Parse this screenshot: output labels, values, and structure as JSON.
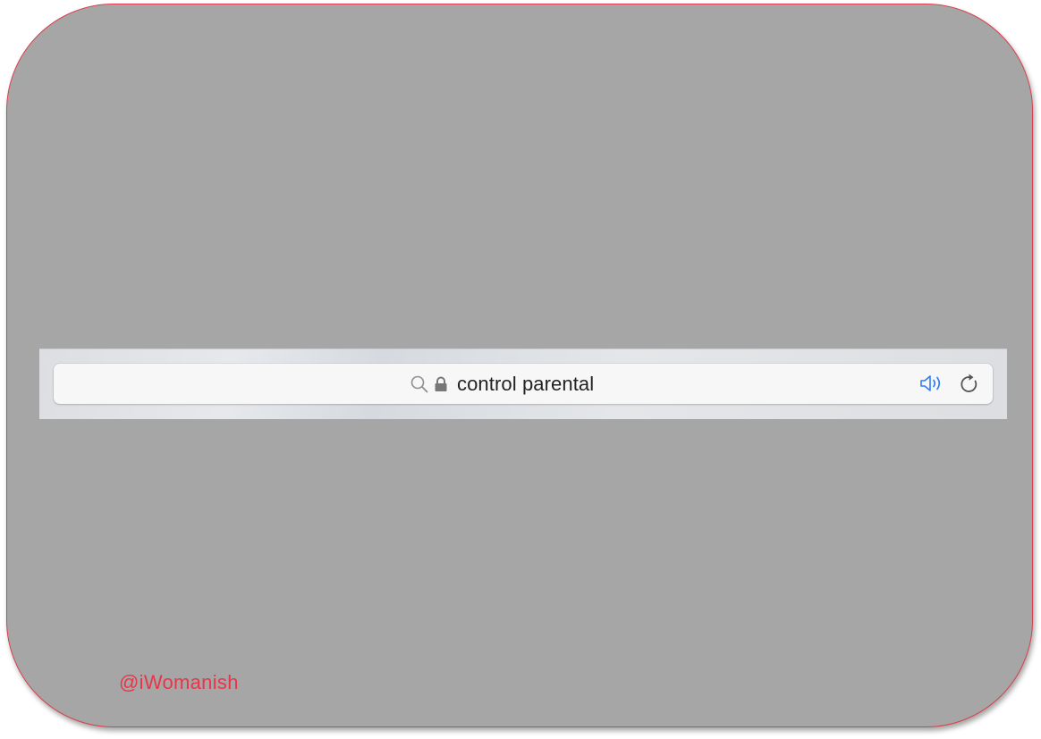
{
  "address_bar": {
    "url_text": "control parental"
  },
  "icons": {
    "search": "search-icon",
    "lock": "lock-icon",
    "audio": "speaker-icon",
    "reload": "reload-icon"
  },
  "watermark": {
    "text": "@iWomanish"
  },
  "colors": {
    "frame_border": "#d8404f",
    "background": "#a6a6a6",
    "audio_icon": "#2f7cf6",
    "watermark": "#e8354a"
  }
}
